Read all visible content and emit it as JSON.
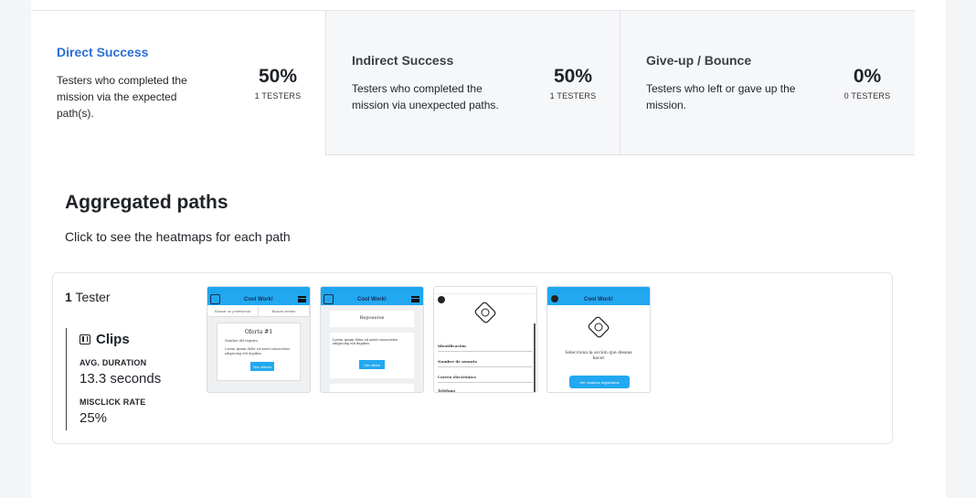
{
  "summary": {
    "direct": {
      "title": "Direct Success",
      "desc": "Testers who completed the mission via the expected path(s).",
      "percent": "50%",
      "testers": "1 TESTERS"
    },
    "indirect": {
      "title": "Indirect Success",
      "desc": "Testers who completed the mission via unexpected paths.",
      "percent": "50%",
      "testers": "1 TESTERS"
    },
    "giveup": {
      "title": "Give-up / Bounce",
      "desc": "Testers who left or gave up the mission.",
      "percent": "0%",
      "testers": "0 TESTERS"
    }
  },
  "aggregated": {
    "title": "Aggregated paths",
    "subtitle": "Click to see the heatmaps for each path"
  },
  "path": {
    "tester_count": "1",
    "tester_label": "Tester",
    "clips_label": "Clips",
    "avg_duration_label": "AVG. DURATION",
    "avg_duration_value": "13.3 seconds",
    "misclick_label": "MISCLICK RATE",
    "misclick_value": "25%"
  },
  "thumbs": {
    "app_title": "Cool Work!",
    "t1": {
      "tab1": "Buscar un profesional",
      "tab2": "Buscar ofertas",
      "offer_title": "Oferta #1",
      "offer_line1": "Nombre del registro",
      "offer_line2": "Lorem ipsum dolor sit amet consectetur adipiscing elit dapibus",
      "button": "Ver oferta"
    },
    "t2": {
      "heading": "Reponerse",
      "line1": "Lorem ipsum dolor sit amet consectetur adipiscing elit dapibus",
      "button": "Ver oferta"
    },
    "t3": {
      "field1": "Identificación",
      "field2": "Nombre de usuario",
      "field3": "Correo electrónico",
      "field4": "Teléfono"
    },
    "t4": {
      "text": "Selecciona la acción que deseas hacer",
      "button": "Ver usuarios registrados"
    }
  },
  "colors": {
    "accent": "#2a6fd6",
    "app_bar": "#22a8f0"
  }
}
